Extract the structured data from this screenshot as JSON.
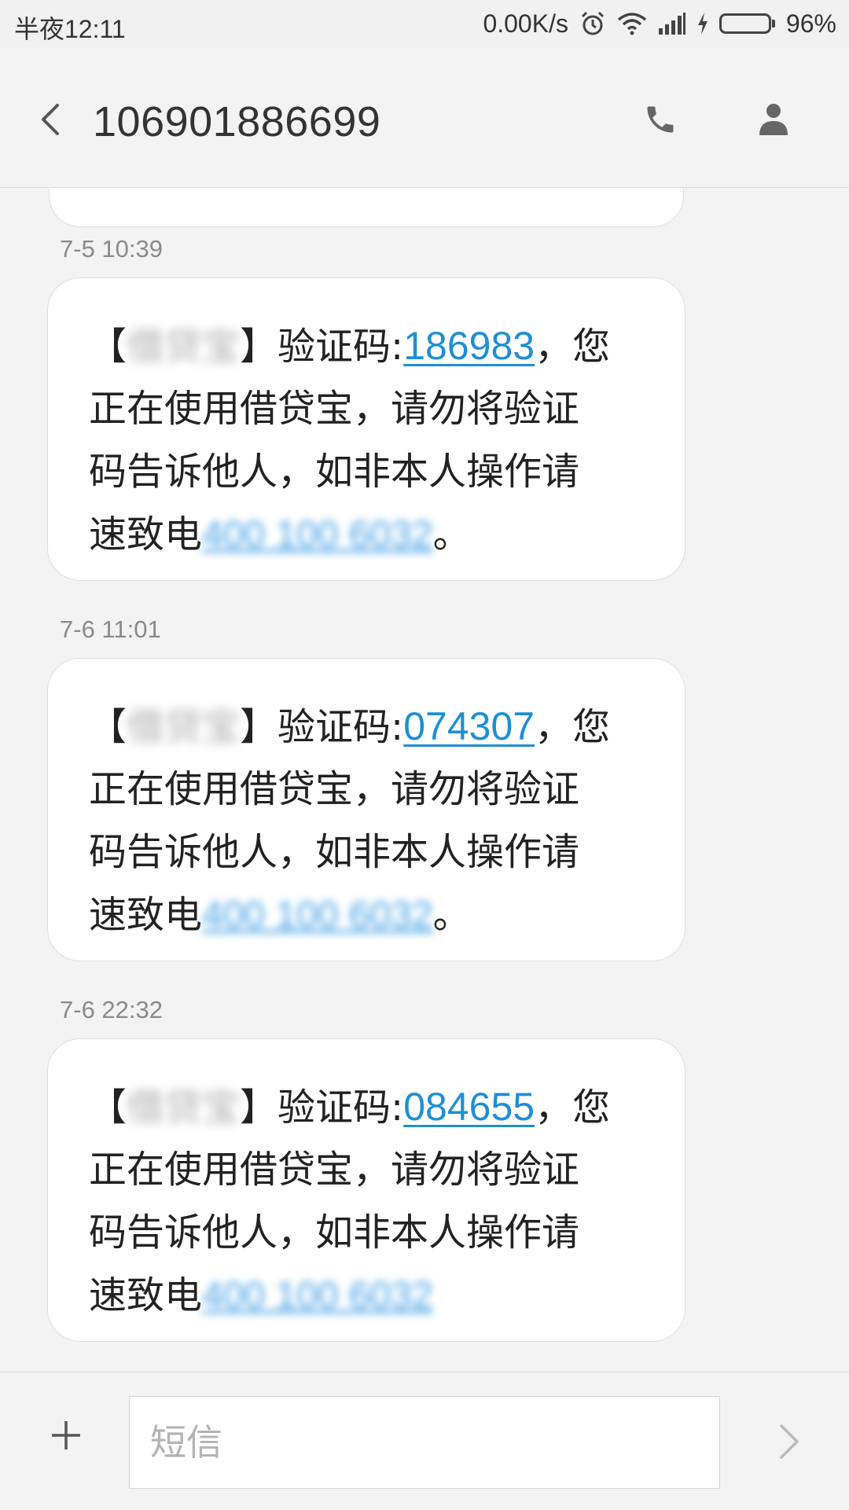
{
  "status_bar": {
    "time": "半夜12:11",
    "net_speed": "0.00K/s",
    "battery_percent": "96%",
    "battery_level": 0.96
  },
  "header": {
    "title": "106901886699",
    "icons": [
      "chevron-left-icon",
      "phone-icon",
      "contact-icon"
    ]
  },
  "messages": [
    {
      "time": "7-5 10:39",
      "sender": "借贷宝",
      "code_label": "验证码:",
      "code": "186983",
      "after_code": "，您",
      "line2": "正在使用借贷宝，请勿将验证",
      "line3": "码告诉他人，如非本人操作请",
      "line4_prefix": "速致电",
      "phone": "400 100 6032",
      "end": "。"
    },
    {
      "time": "7-6 11:01",
      "sender": "借贷宝",
      "code_label": "验证码:",
      "code": "074307",
      "after_code": "，您",
      "line2": "正在使用借贷宝，请勿将验证",
      "line3": "码告诉他人，如非本人操作请",
      "line4_prefix": "速致电",
      "phone": "400 100 6032",
      "end": "。"
    },
    {
      "time": "7-6 22:32",
      "sender": "借贷宝",
      "code_label": "验证码:",
      "code": "084655",
      "after_code": "，您",
      "line2": "正在使用借贷宝，请勿将验证",
      "line3": "码告诉他人，如非本人操作请",
      "line4_prefix": "速致电",
      "phone": "400 100 6032",
      "end": ""
    }
  ],
  "composer": {
    "placeholder": "短信",
    "icons": [
      "plus-icon",
      "send-icon"
    ]
  },
  "colors": {
    "link": "#1e8fd6",
    "battery": "#3cc82a",
    "background": "#f3f3f3"
  }
}
